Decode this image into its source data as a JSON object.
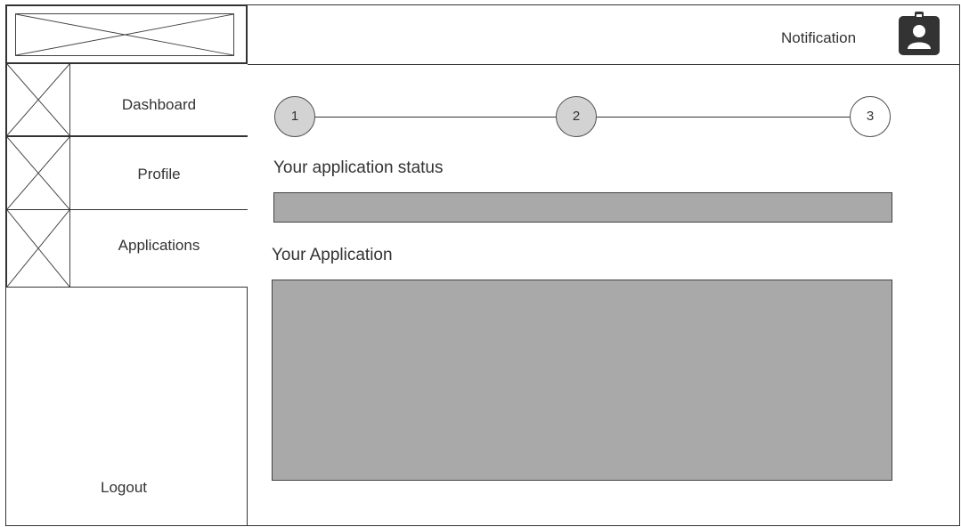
{
  "header": {
    "notification_label": "Notification",
    "profile_icon": "profile-badge-icon",
    "logo_icon": "image-placeholder-icon"
  },
  "sidebar": {
    "items": [
      {
        "label": "Dashboard",
        "icon": "image-placeholder-icon"
      },
      {
        "label": "Profile",
        "icon": "image-placeholder-icon"
      },
      {
        "label": "Applications",
        "icon": "image-placeholder-icon"
      }
    ],
    "logout_label": "Logout"
  },
  "main": {
    "steps": [
      {
        "label": "1",
        "state": "done"
      },
      {
        "label": "2",
        "state": "done"
      },
      {
        "label": "3",
        "state": "pending"
      }
    ],
    "status_title": "Your application status",
    "application_title": "Your Application"
  },
  "colors": {
    "panel_fill": "#a9a9a9",
    "step_done_fill": "#d3d3d3",
    "icon_dark": "#333333"
  }
}
